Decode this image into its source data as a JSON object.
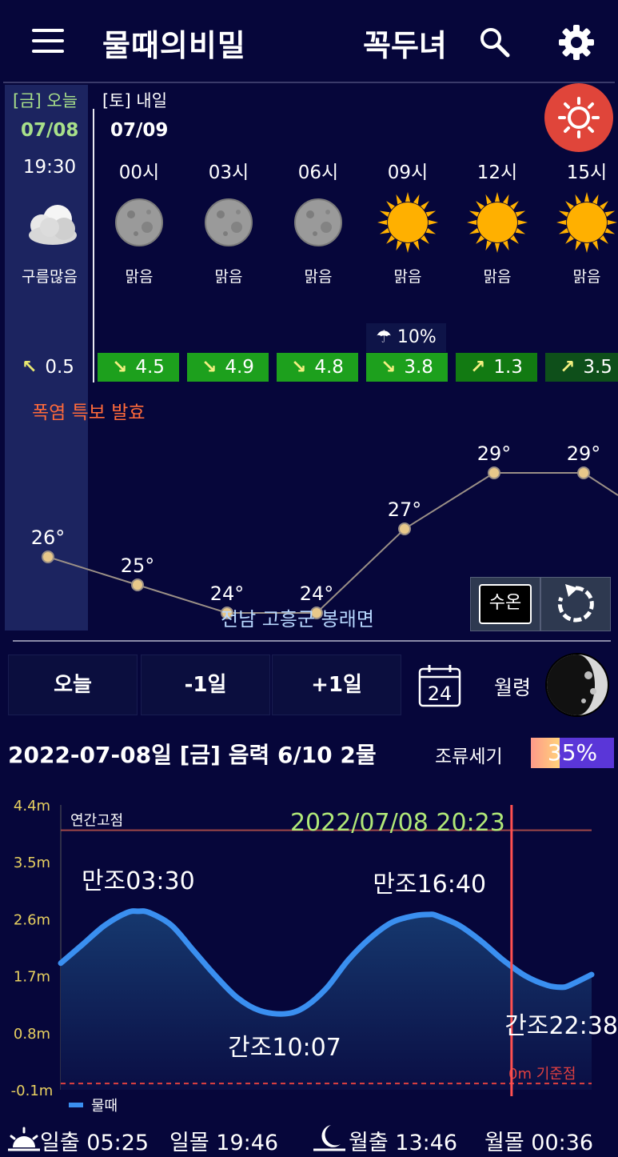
{
  "header": {
    "title": "물때의비밀",
    "location": "꼭두녀"
  },
  "forecast": {
    "today_label": "[금] 오늘",
    "tomorrow_label": "[토] 내일",
    "today_date": "07/08",
    "tomorrow_date": "07/09",
    "slots": [
      {
        "time": "19:30",
        "icon": "cloudy-icon",
        "condition": "구름많음",
        "wind_dir": "↖",
        "wind_speed": "0.5"
      },
      {
        "time": "00시",
        "icon": "moon-clear-icon",
        "condition": "맑음",
        "wind_dir": "↘",
        "wind_speed": "4.5"
      },
      {
        "time": "03시",
        "icon": "moon-clear-icon",
        "condition": "맑음",
        "wind_dir": "↘",
        "wind_speed": "4.9"
      },
      {
        "time": "06시",
        "icon": "moon-clear-icon",
        "condition": "맑음",
        "wind_dir": "↘",
        "wind_speed": "4.8"
      },
      {
        "time": "09시",
        "icon": "sun-icon",
        "condition": "맑음",
        "wind_dir": "↘",
        "wind_speed": "3.8"
      },
      {
        "time": "12시",
        "icon": "sun-icon",
        "condition": "맑음",
        "wind_dir": "↗",
        "wind_speed": "1.3"
      },
      {
        "time": "15시",
        "icon": "sun-icon",
        "condition": "맑음",
        "wind_dir": "↗",
        "wind_speed": "3.5"
      }
    ],
    "rain_chance": "10%",
    "heat_warning": "폭염 특보 발효",
    "temperatures": [
      "26°",
      "25°",
      "24°",
      "24°",
      "27°",
      "29°",
      "29°"
    ],
    "water_temp_button": "수온",
    "region": "전남 고흥군 봉래면"
  },
  "nav": {
    "today": "오늘",
    "prev_day": "-1일",
    "next_day": "+1일",
    "calendar_day": "24",
    "moon_phase_label": "월령"
  },
  "tide": {
    "date_line": "2022-07-08일 [금] 음력 6/10  2물",
    "flow_label": "조류세기",
    "flow_strength": "35%",
    "flow_fraction": 0.35
  },
  "chart_data": {
    "type": "area",
    "title": "",
    "xlabel": "",
    "ylabel": "",
    "y_ticks": [
      "4.4m",
      "3.5m",
      "2.6m",
      "1.7m",
      "0.8m",
      "-0.1m"
    ],
    "ylim": [
      -0.1,
      4.4
    ],
    "xlim_hours": [
      0,
      24
    ],
    "series": [
      {
        "name": "물때",
        "x_hours": [
          0,
          1,
          2,
          3,
          3.5,
          4,
          5,
          6,
          7,
          8,
          9,
          10.12,
          11,
          12,
          13,
          14,
          15,
          16,
          16.67,
          17,
          18,
          19,
          20,
          21,
          22,
          22.63,
          23,
          24
        ],
        "y": [
          1.9,
          2.2,
          2.5,
          2.7,
          2.72,
          2.7,
          2.5,
          2.1,
          1.7,
          1.35,
          1.15,
          1.1,
          1.2,
          1.5,
          1.95,
          2.3,
          2.55,
          2.65,
          2.67,
          2.65,
          2.5,
          2.25,
          1.95,
          1.7,
          1.55,
          1.52,
          1.55,
          1.72
        ]
      }
    ],
    "annotations": [
      {
        "text": "만조03:30",
        "x_hours": 3.5,
        "y": 2.72
      },
      {
        "text": "간조10:07",
        "x_hours": 10.12,
        "y": 1.1
      },
      {
        "text": "만조16:40",
        "x_hours": 16.67,
        "y": 2.67
      },
      {
        "text": "간조22:38",
        "x_hours": 22.63,
        "y": 1.52
      }
    ],
    "reference_lines": [
      {
        "label": "연간고점",
        "y": 4.0
      },
      {
        "label": "0m 기준점",
        "y": 0.0
      }
    ],
    "current_time_label": "2022/07/08 20:23",
    "current_time_hours": 20.38,
    "legend": "bottom-left",
    "grid": false,
    "colors": {
      "line": "#3a8ff0",
      "current_time": "#ff5050",
      "high_line": "#a04848",
      "zero_line": "#e04040"
    }
  },
  "footer": {
    "sunrise": "일출 05:25",
    "sunset": "일몰 19:46",
    "moonrise": "월출 13:46",
    "moonset": "월몰 00:36"
  }
}
